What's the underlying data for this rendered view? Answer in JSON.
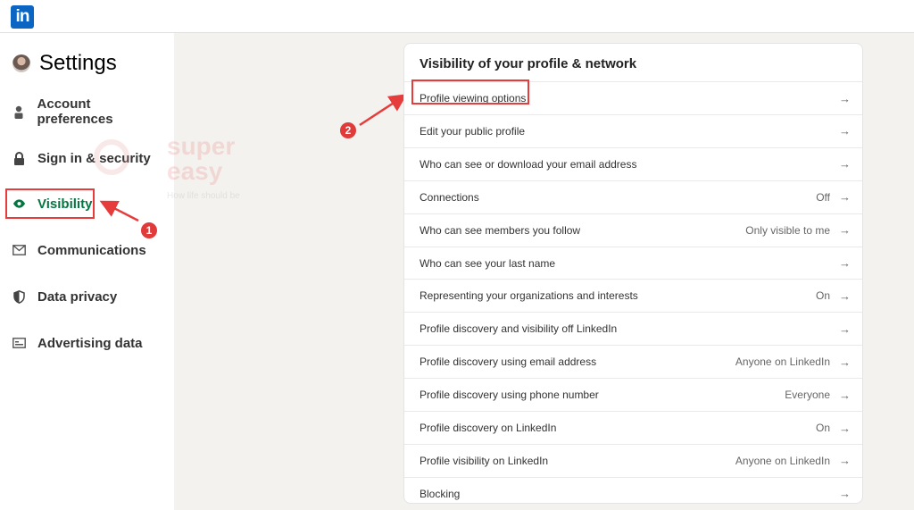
{
  "app": {
    "logo_text": "in"
  },
  "sidebar": {
    "title": "Settings",
    "items": [
      {
        "label": "Account preferences",
        "icon": "person-icon",
        "active": false
      },
      {
        "label": "Sign in & security",
        "icon": "lock-icon",
        "active": false
      },
      {
        "label": "Visibility",
        "icon": "eye-icon",
        "active": true
      },
      {
        "label": "Communications",
        "icon": "envelope-icon",
        "active": false
      },
      {
        "label": "Data privacy",
        "icon": "shield-icon",
        "active": false
      },
      {
        "label": "Advertising data",
        "icon": "ad-icon",
        "active": false
      }
    ]
  },
  "watermark": {
    "line1": "super",
    "line2": "easy",
    "tagline": "How life should be"
  },
  "annotations": {
    "step1": "1",
    "step2": "2"
  },
  "card": {
    "title": "Visibility of your profile & network",
    "rows": [
      {
        "label": "Profile viewing options",
        "value": ""
      },
      {
        "label": "Edit your public profile",
        "value": ""
      },
      {
        "label": "Who can see or download your email address",
        "value": ""
      },
      {
        "label": "Connections",
        "value": "Off"
      },
      {
        "label": "Who can see members you follow",
        "value": "Only visible to me"
      },
      {
        "label": "Who can see your last name",
        "value": ""
      },
      {
        "label": "Representing your organizations and interests",
        "value": "On"
      },
      {
        "label": "Profile discovery and visibility off LinkedIn",
        "value": ""
      },
      {
        "label": "Profile discovery using email address",
        "value": "Anyone on LinkedIn"
      },
      {
        "label": "Profile discovery using phone number",
        "value": "Everyone"
      },
      {
        "label": "Profile discovery on LinkedIn",
        "value": "On"
      },
      {
        "label": "Profile visibility on LinkedIn",
        "value": "Anyone on LinkedIn"
      },
      {
        "label": "Blocking",
        "value": ""
      }
    ],
    "arrow_glyph": "→"
  },
  "colors": {
    "brand": "#0a66c2",
    "active": "#057642",
    "annotation": "#e63c3c"
  }
}
